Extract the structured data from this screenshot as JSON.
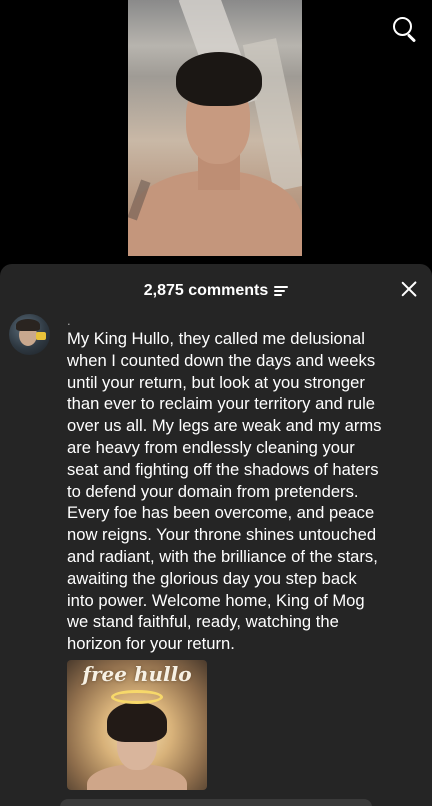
{
  "video": {
    "search_icon": "search-icon"
  },
  "comments_sheet": {
    "count_label": "2,875 comments",
    "filter_icon": "filter-icon",
    "close_icon": "close-icon",
    "comment": {
      "username": ".",
      "text": "My King Hullo, they called me delusional\nwhen I counted down the days and weeks\nuntil your return, but look at you stronger\nthan ever to reclaim your territory and rule\nover us all. My legs are weak and my arms\nare heavy from endlessly cleaning your\nseat and fighting off the shadows of haters\nto defend your domain from pretenders.\nEvery foe has been overcome, and peace\nnow reigns. Your throne shines untouched\nand radiant, with the brilliance of the stars,\nawaiting the glorious day you step back\ninto power. Welcome home, King of Mog\nwe stand faithful, ready, watching the\nhorizon for your return.",
      "image_caption": "free hullo"
    }
  }
}
